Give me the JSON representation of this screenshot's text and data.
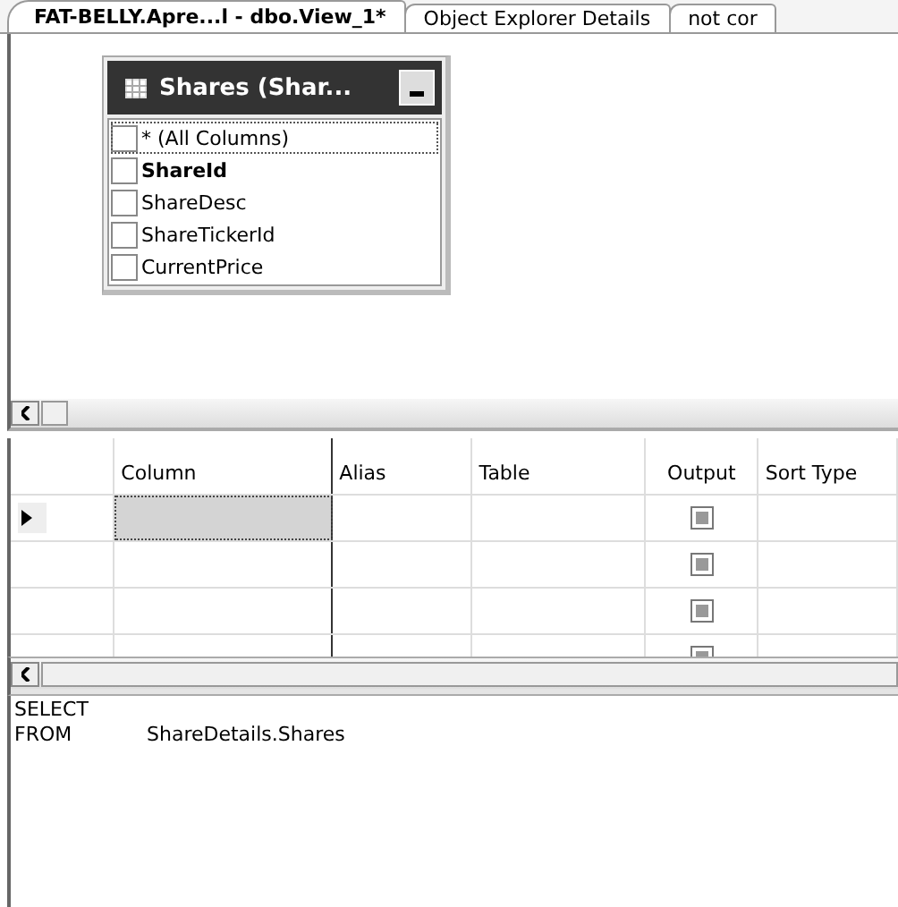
{
  "tabs": [
    {
      "label": "FAT-BELLY.Apre...l - dbo.View_1*",
      "selected": true
    },
    {
      "label": "Object Explorer Details",
      "selected": false
    },
    {
      "label": "not cor",
      "selected": false
    }
  ],
  "table_box": {
    "title": "Shares (Shar...",
    "columns": [
      {
        "name": "* (All Columns)",
        "checked": false,
        "focused": true,
        "key": false
      },
      {
        "name": "ShareId",
        "checked": false,
        "focused": false,
        "key": true
      },
      {
        "name": "ShareDesc",
        "checked": false,
        "focused": false,
        "key": false
      },
      {
        "name": "ShareTickerId",
        "checked": false,
        "focused": false,
        "key": false
      },
      {
        "name": "CurrentPrice",
        "checked": false,
        "focused": false,
        "key": false
      }
    ]
  },
  "grid": {
    "columns": [
      "Column",
      "Alias",
      "Table",
      "Output",
      "Sort Type"
    ],
    "rows": [
      {
        "current": true,
        "output": true
      },
      {
        "current": false,
        "output": true
      },
      {
        "current": false,
        "output": true
      },
      {
        "current": false,
        "output": true
      }
    ]
  },
  "sql": [
    {
      "keyword": "SELECT"
    },
    {
      "keyword": "FROM",
      "text": "ShareDetails.Shares"
    }
  ]
}
